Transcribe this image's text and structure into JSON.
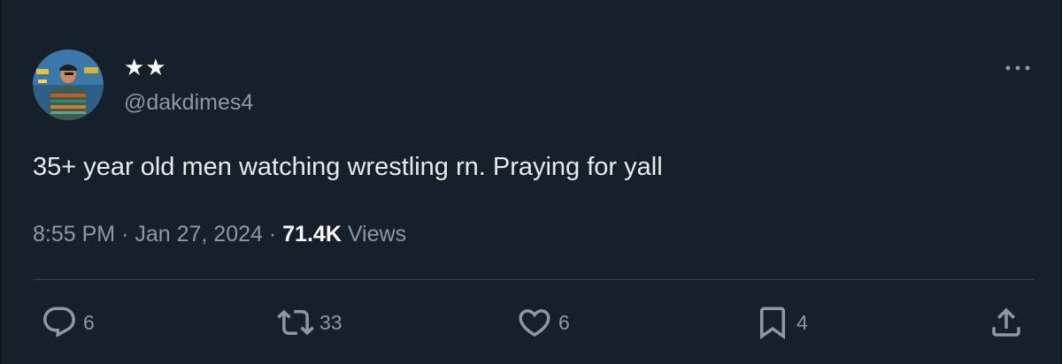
{
  "author": {
    "display_name": "★★",
    "handle": "@dakdimes4"
  },
  "tweet": {
    "text": "35+ year old men watching wrestling rn. Praying for yall",
    "time": "8:55 PM",
    "date": "Jan 27, 2024",
    "views_count": "71.4K",
    "views_label": "Views",
    "separator": "·"
  },
  "actions": {
    "replies": "6",
    "retweets": "33",
    "likes": "6",
    "bookmarks": "4"
  },
  "icons": {
    "more": "more-horizontal-icon",
    "reply": "reply-icon",
    "retweet": "retweet-icon",
    "like": "heart-icon",
    "bookmark": "bookmark-icon",
    "share": "share-icon"
  },
  "colors": {
    "background": "#16202b",
    "text_primary": "#e7e9ea",
    "text_secondary": "#8b98a5",
    "divider": "#38444d"
  }
}
